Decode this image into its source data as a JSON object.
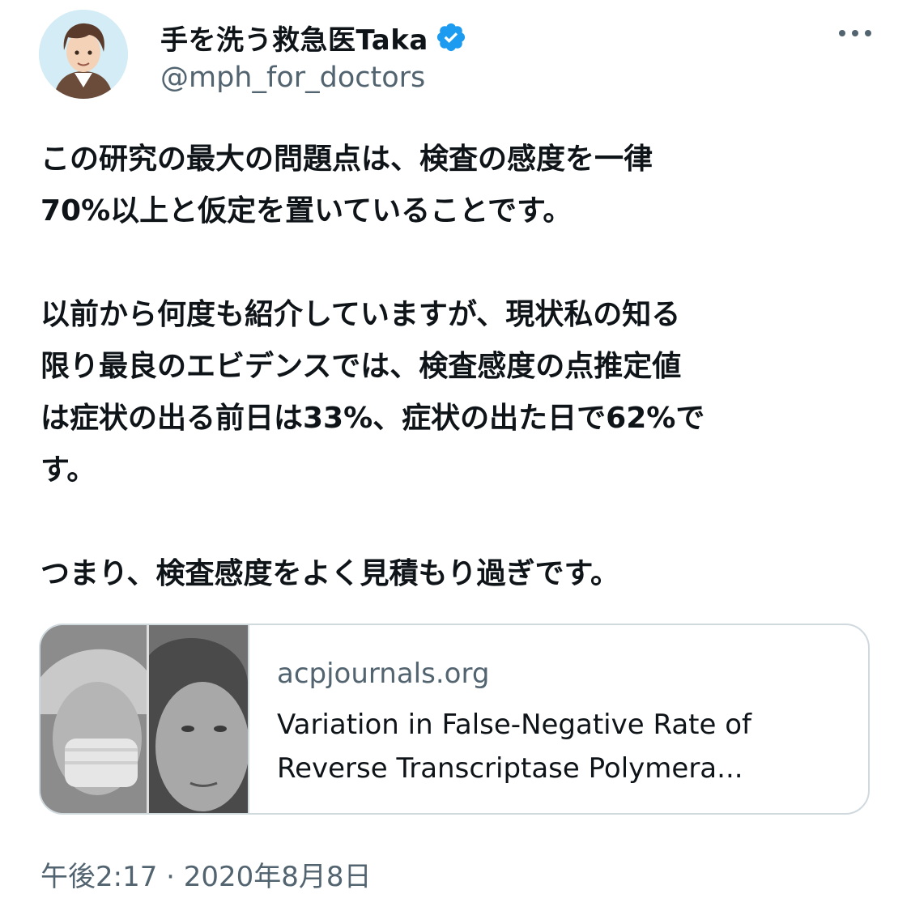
{
  "author": {
    "display_name": "手を洗う救急医Taka",
    "handle": "@mph_for_doctors",
    "verified_icon": "verified-badge-icon",
    "verified_color": "#1d9bf0"
  },
  "tweet": {
    "paragraphs": [
      [
        "この研究の最大の問題点は、検査の感度を一律",
        "70%以上と仮定を置いていることです。"
      ],
      [
        "以前から何度も紹介していますが、現状私の知る",
        "限り最良のエビデンスでは、検査感度の点推定値",
        "は症状の出る前日は33%、症状の出た日で62%で",
        "す。"
      ],
      [
        "つまり、検査感度をよく見積もり過ぎです。"
      ]
    ]
  },
  "link_card": {
    "domain": "acpjournals.org",
    "title_line1": "Variation in False-Negative Rate of",
    "title_line2": "Reverse Transcriptase Polymera..."
  },
  "timestamp": "午後2:17 · 2020年8月8日",
  "colors": {
    "text": "#0f1419",
    "secondary": "#536471",
    "border": "#cfd9de"
  }
}
